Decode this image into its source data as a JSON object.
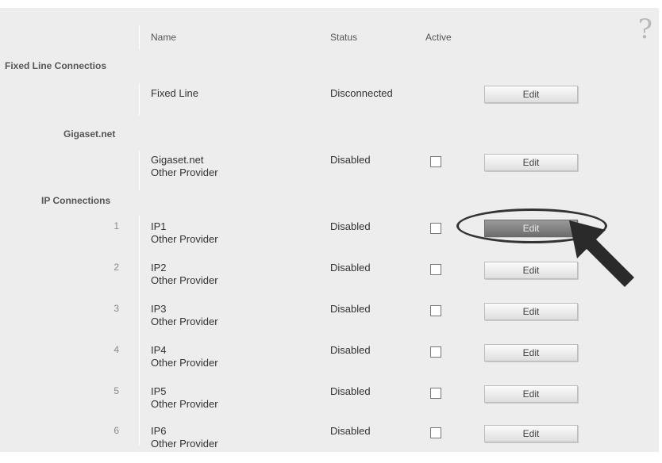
{
  "header": {
    "name": "Name",
    "status": "Status",
    "active": "Active",
    "help": "?"
  },
  "sections": {
    "fixed": "Fixed Line Connectios",
    "gigaset": "Gigaset.net",
    "ip": "IP Connections"
  },
  "rows": {
    "fixed": {
      "name": "Fixed Line",
      "status": "Disconnected",
      "button": "Edit"
    },
    "gigaset": {
      "name1": "Gigaset.net",
      "name2": "Other Provider",
      "status": "Disabled",
      "button": "Edit"
    },
    "ip": [
      {
        "num": "1",
        "name1": "IP1",
        "name2": "Other Provider",
        "status": "Disabled",
        "button": "Edit"
      },
      {
        "num": "2",
        "name1": "IP2",
        "name2": "Other Provider",
        "status": "Disabled",
        "button": "Edit"
      },
      {
        "num": "3",
        "name1": "IP3",
        "name2": "Other Provider",
        "status": "Disabled",
        "button": "Edit"
      },
      {
        "num": "4",
        "name1": "IP4",
        "name2": "Other Provider",
        "status": "Disabled",
        "button": "Edit"
      },
      {
        "num": "5",
        "name1": "IP5",
        "name2": "Other Provider",
        "status": "Disabled",
        "button": "Edit"
      },
      {
        "num": "6",
        "name1": "IP6",
        "name2": "Other Provider",
        "status": "Disabled",
        "button": "Edit"
      }
    ]
  },
  "colors": {
    "panel": "#ededed",
    "highlight_button": "#7d7d7d",
    "annotation": "#333333"
  }
}
